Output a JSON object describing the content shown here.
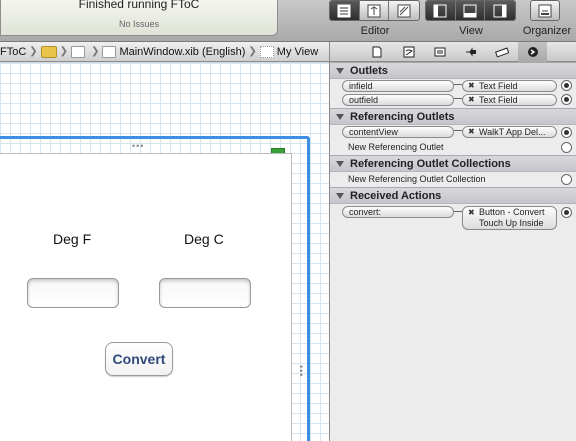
{
  "status": {
    "line1": "Finished running FToC",
    "line2": "No Issues"
  },
  "toolbar": {
    "editor_label": "Editor",
    "view_label": "View",
    "organizer_label": "Organizer",
    "editor_icons": [
      "standard-editor-icon",
      "assistant-editor-icon",
      "version-editor-icon"
    ],
    "view_icons": [
      "navigator-toggle-icon",
      "debug-area-toggle-icon",
      "utilities-toggle-icon"
    ]
  },
  "jumpbar": {
    "project": "FToC",
    "file": "MainWindow.xib (English)",
    "object": "My View"
  },
  "canvas": {
    "label_f": "Deg F",
    "label_c": "Deg C",
    "convert_label": "Convert"
  },
  "inspector": {
    "tabs": [
      "file-inspector",
      "quick-help",
      "identity-inspector",
      "attributes-inspector",
      "size-inspector",
      "connections-inspector"
    ],
    "outlets_title": "Outlets",
    "outlets": [
      {
        "name": "infield",
        "target": "Text Field"
      },
      {
        "name": "outfield",
        "target": "Text Field"
      }
    ],
    "ref_outlets_title": "Referencing Outlets",
    "ref_outlet": {
      "name": "contentView",
      "target": "WalkT App Del..."
    },
    "new_ref_outlet": "New Referencing Outlet",
    "ref_collections_title": "Referencing Outlet Collections",
    "new_ref_collection": "New Referencing Outlet Collection",
    "actions_title": "Received Actions",
    "action": {
      "name": "convert:",
      "target_line1": "Button - Convert",
      "target_line2": "Touch Up Inside"
    }
  }
}
